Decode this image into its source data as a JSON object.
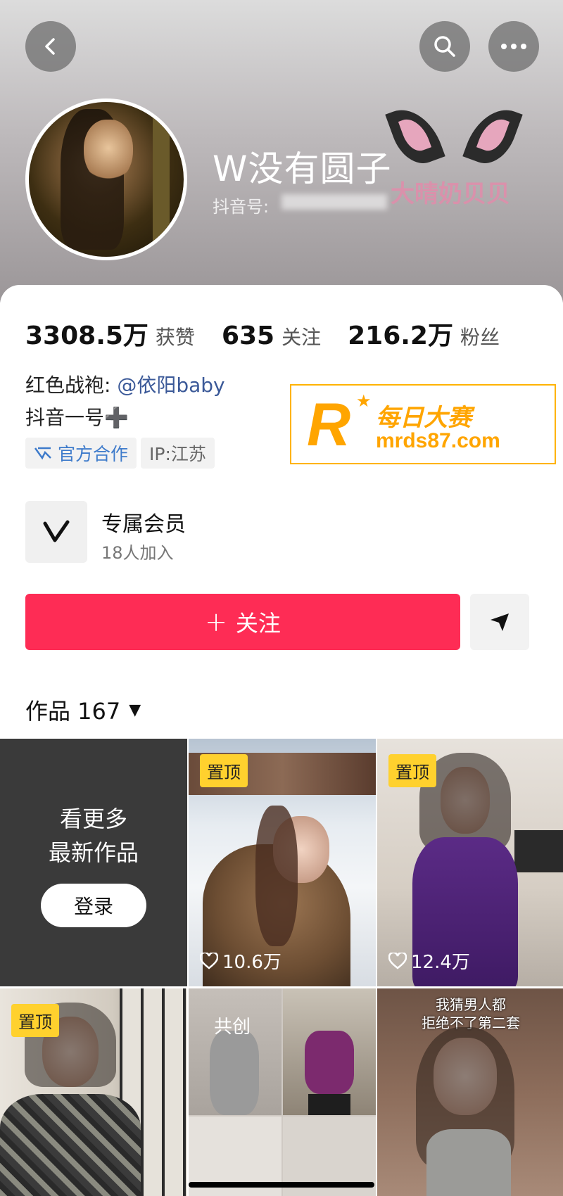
{
  "profile": {
    "nickname": "W没有圆子",
    "douyin_id_label": "抖音号:",
    "overlay_text": "大晴奶贝贝"
  },
  "stats": [
    {
      "value": "3308.5万",
      "label": "获赞"
    },
    {
      "value": "635",
      "label": "关注"
    },
    {
      "value": "216.2万",
      "label": "粉丝"
    }
  ],
  "bio": {
    "line1_prefix": "红色战袍:",
    "line1_mention": "@依阳baby",
    "line2": "抖音一号➕"
  },
  "tags": {
    "official": "官方合作",
    "ip": "IP:江苏"
  },
  "ad": {
    "letter": "R",
    "cn": "每日大赛",
    "url": "mrds87.com"
  },
  "member": {
    "title": "专属会员",
    "subtitle": "18人加入"
  },
  "actions": {
    "follow_plus": "+",
    "follow_label": "关注"
  },
  "works": {
    "label": "作品 167"
  },
  "grid": {
    "cta_line1": "看更多",
    "cta_line2": "最新作品",
    "login_label": "登录",
    "items": [
      {
        "badge": "置顶",
        "likes": "10.6万"
      },
      {
        "badge": "置顶",
        "likes": "12.4万"
      },
      {
        "badge": "置顶"
      },
      {
        "badge": "共创"
      },
      {
        "caption_line1": "我猜男人都",
        "caption_line2": "拒绝不了第二套"
      }
    ]
  },
  "colors": {
    "follow": "#fe2c55",
    "official_tag": "#3e7bcb",
    "pin_badge": "#ffd12e",
    "ad_accent": "#ffa500"
  },
  "icons": [
    "back-icon",
    "search-icon",
    "more-icon",
    "membership-v-icon",
    "share-send-icon",
    "official-partner-icon",
    "heart-icon",
    "dropdown-caret-icon"
  ]
}
